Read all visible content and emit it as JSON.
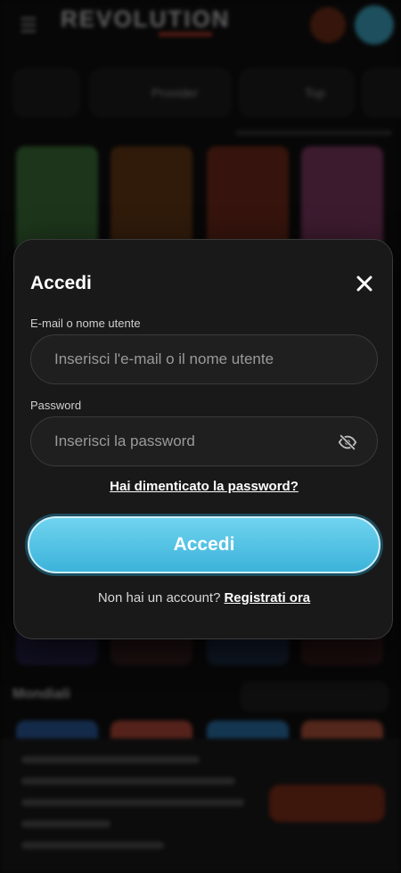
{
  "modal": {
    "title": "Accedi",
    "email_label": "E-mail o nome utente",
    "email_placeholder": "Inserisci l'e-mail o il nome utente",
    "email_value": "",
    "password_label": "Password",
    "password_placeholder": "Inserisci la password",
    "password_value": "",
    "forgot_link": "Hai dimenticato la password?",
    "login_button": "Accedi",
    "no_account_text": "Non hai un account?",
    "signup_link": "Registrati ora"
  },
  "icons": {
    "close": "close-icon",
    "eye": "eye-off-icon",
    "menu": "menu-icon"
  },
  "colors": {
    "accent": "#4cc3e6",
    "modal_bg": "#191919",
    "page_bg": "#050505"
  },
  "background": {
    "logo": "REVOLUTION",
    "categories": [
      "Provider",
      "Top"
    ],
    "section_title": "Mondiali"
  }
}
